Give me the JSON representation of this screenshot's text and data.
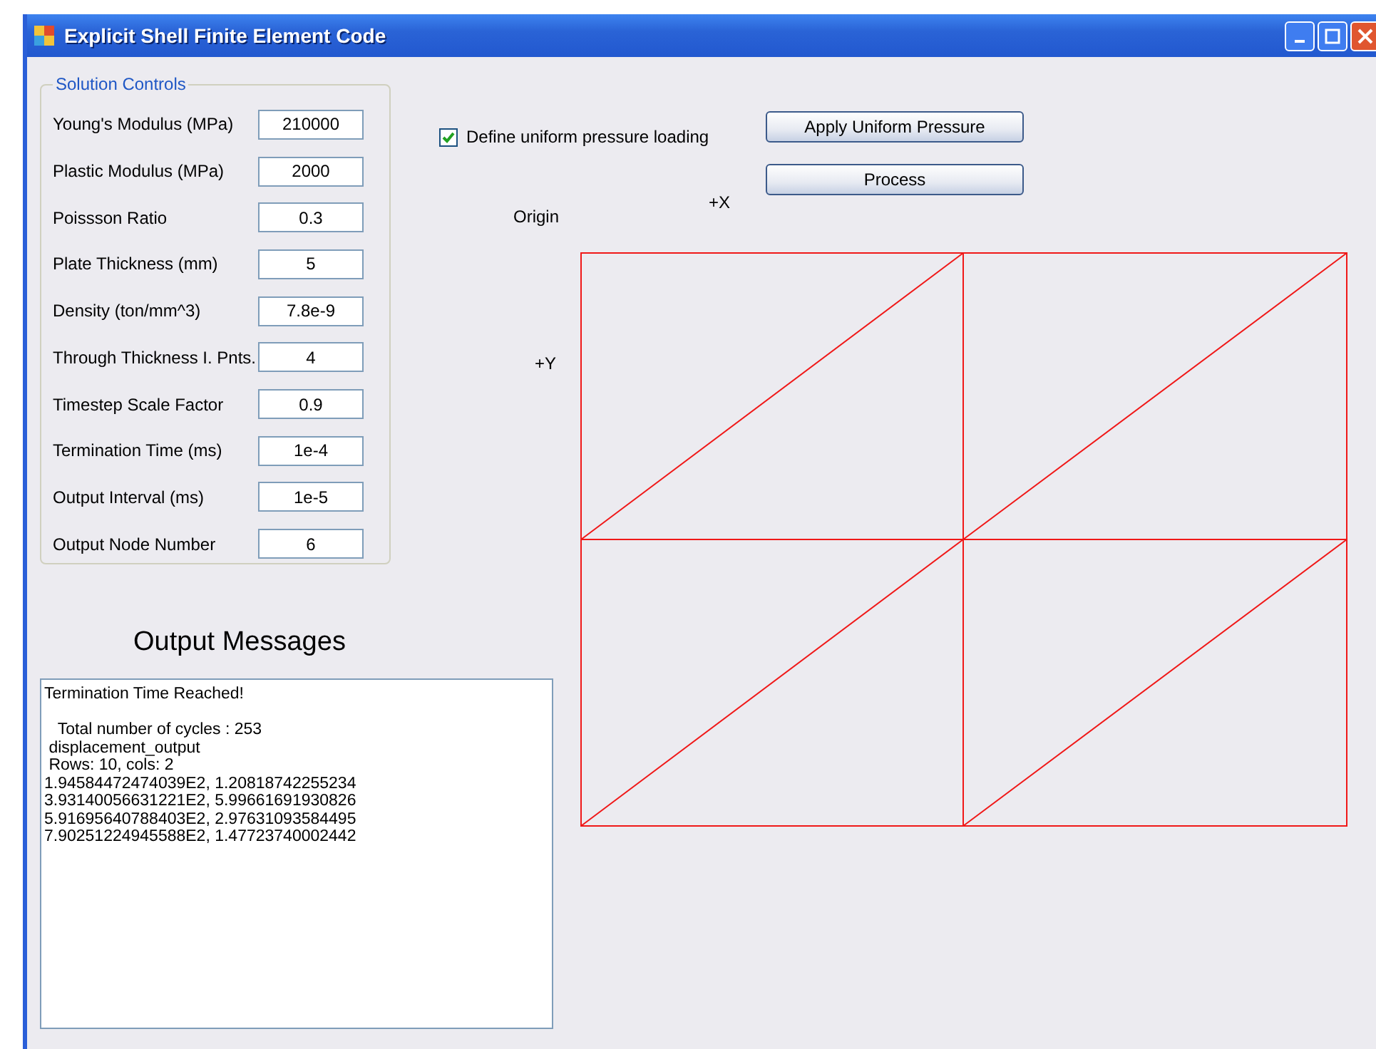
{
  "window": {
    "title": "Explicit Shell Finite Element Code"
  },
  "solution_controls": {
    "title": "Solution Controls",
    "fields": [
      {
        "label": "Young's Modulus (MPa)",
        "value": "210000"
      },
      {
        "label": "Plastic Modulus (MPa)",
        "value": "2000"
      },
      {
        "label": "Poissson Ratio",
        "value": "0.3"
      },
      {
        "label": "Plate Thickness (mm)",
        "value": "5"
      },
      {
        "label": "Density (ton/mm^3)",
        "value": "7.8e-9"
      },
      {
        "label": "Through Thickness I. Pnts.",
        "value": "4"
      },
      {
        "label": "Timestep Scale Factor",
        "value": "0.9"
      },
      {
        "label": "Termination Time (ms)",
        "value": "1e-4"
      },
      {
        "label": "Output Interval (ms)",
        "value": "1e-5"
      },
      {
        "label": "Output Node Number",
        "value": "6"
      }
    ]
  },
  "pressure_checkbox": {
    "label": "Define uniform pressure loading",
    "checked": true
  },
  "buttons": [
    "Apply Uniform Pressure",
    "Process"
  ],
  "mesh": {
    "origin_label": "Origin",
    "x_label": "+X",
    "y_label": "+Y"
  },
  "output": {
    "title": "Output Messages",
    "value": "Termination Time Reached!\n\n   Total number of cycles : 253\n displacement_output\n Rows: 10, cols: 2\n1.94584472474039E2, 1.20818742255234\n3.93140056631221E2, 5.99661691930826\n5.91695640788403E2, 2.97631093584495\n7.90251224945588E2, 1.47723740002442"
  }
}
